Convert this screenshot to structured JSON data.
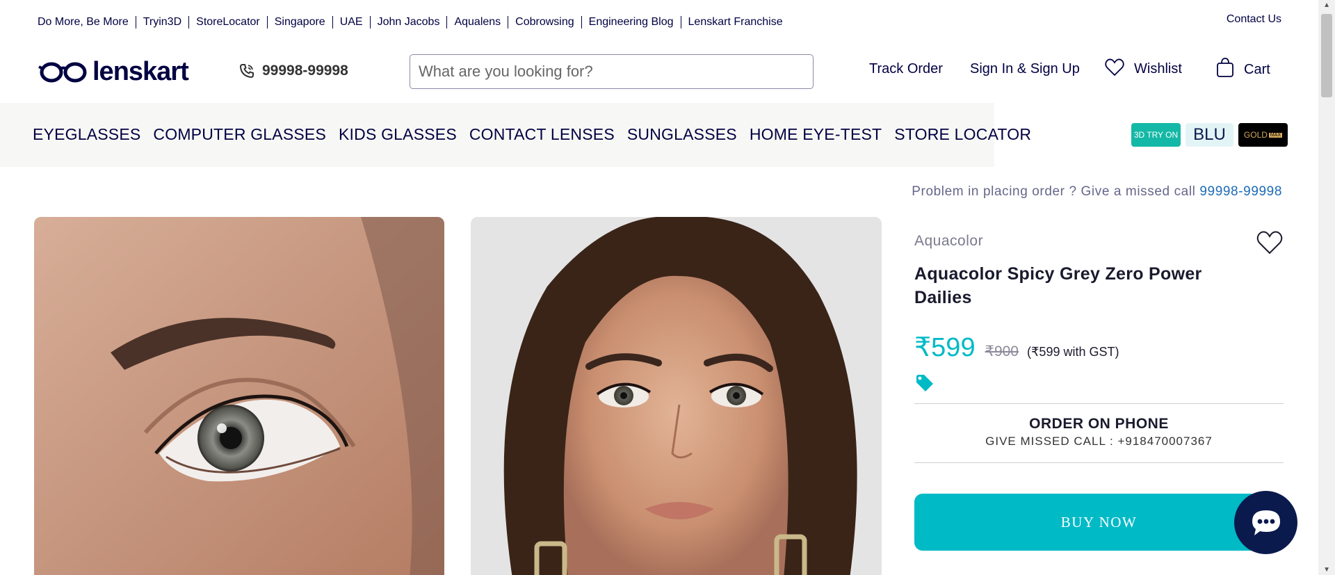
{
  "top_links": [
    "Do More, Be More",
    "Tryin3D",
    "StoreLocator",
    "Singapore",
    "UAE",
    "John Jacobs",
    "Aqualens",
    "Cobrowsing",
    "Engineering Blog",
    "Lenskart Franchise"
  ],
  "contact_label": "Contact Us",
  "logo_text": "lenskart",
  "phone_number": "99998-99998",
  "search": {
    "placeholder": "What are you looking for?"
  },
  "header_nav": {
    "track_order": "Track Order",
    "sign_in": "Sign In & Sign Up",
    "wishlist": "Wishlist",
    "cart": "Cart"
  },
  "categories": [
    "EYEGLASSES",
    "COMPUTER GLASSES",
    "KIDS GLASSES",
    "CONTACT LENSES",
    "SUNGLASSES",
    "HOME EYE-TEST",
    "STORE LOCATOR"
  ],
  "badges": {
    "try3d": "3D TRY ON",
    "blu": "BLU",
    "gold": "GOLD",
    "gold_sub": "MAX"
  },
  "missed_call": {
    "text": "Problem in placing order ? Give a missed call",
    "number": "99998-99998"
  },
  "product": {
    "brand": "Aquacolor",
    "title": "Aquacolor Spicy Grey Zero Power Dailies",
    "price": "₹599",
    "mrp": "₹900",
    "gst_note": "(₹599 with GST)",
    "order_phone_heading": "ORDER ON PHONE",
    "order_phone_sub": "GIVE MISSED CALL : +918470007367",
    "buy_label": "BUY NOW"
  },
  "colors": {
    "navy": "#000042",
    "teal": "#00bac6",
    "nav_bg": "#f7f7f5"
  }
}
